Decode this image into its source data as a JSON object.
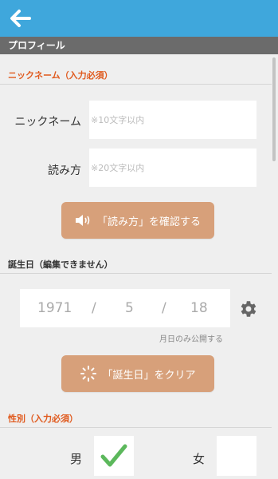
{
  "profile": {
    "section_title": "プロフィール"
  },
  "nickname": {
    "heading": "ニックネーム（入力必須）",
    "nickname_label": "ニックネーム",
    "nickname_placeholder": "※10文字以内",
    "reading_label": "読み方",
    "reading_placeholder": "※20文字以内",
    "confirm_button": "「読み方」を確認する"
  },
  "birthday": {
    "heading": "誕生日（編集できません）",
    "year": "1971",
    "month": "5",
    "day": "18",
    "separator": "/",
    "visibility_note": "月日のみ公開する",
    "clear_button": "「誕生日」をクリア"
  },
  "gender": {
    "heading": "性別（入力必須）",
    "male_label": "男",
    "female_label": "女",
    "selected": "男"
  },
  "colors": {
    "topbar": "#3fa7dc",
    "section_bar": "#6b6b6b",
    "required_heading": "#e05a1e",
    "button": "#d7a07a",
    "check": "#5cb85c"
  },
  "icons": {
    "back": "arrow-left-icon",
    "speaker": "speaker-icon",
    "gear": "gear-icon",
    "spinner": "spinner-icon",
    "check": "checkmark-icon"
  }
}
